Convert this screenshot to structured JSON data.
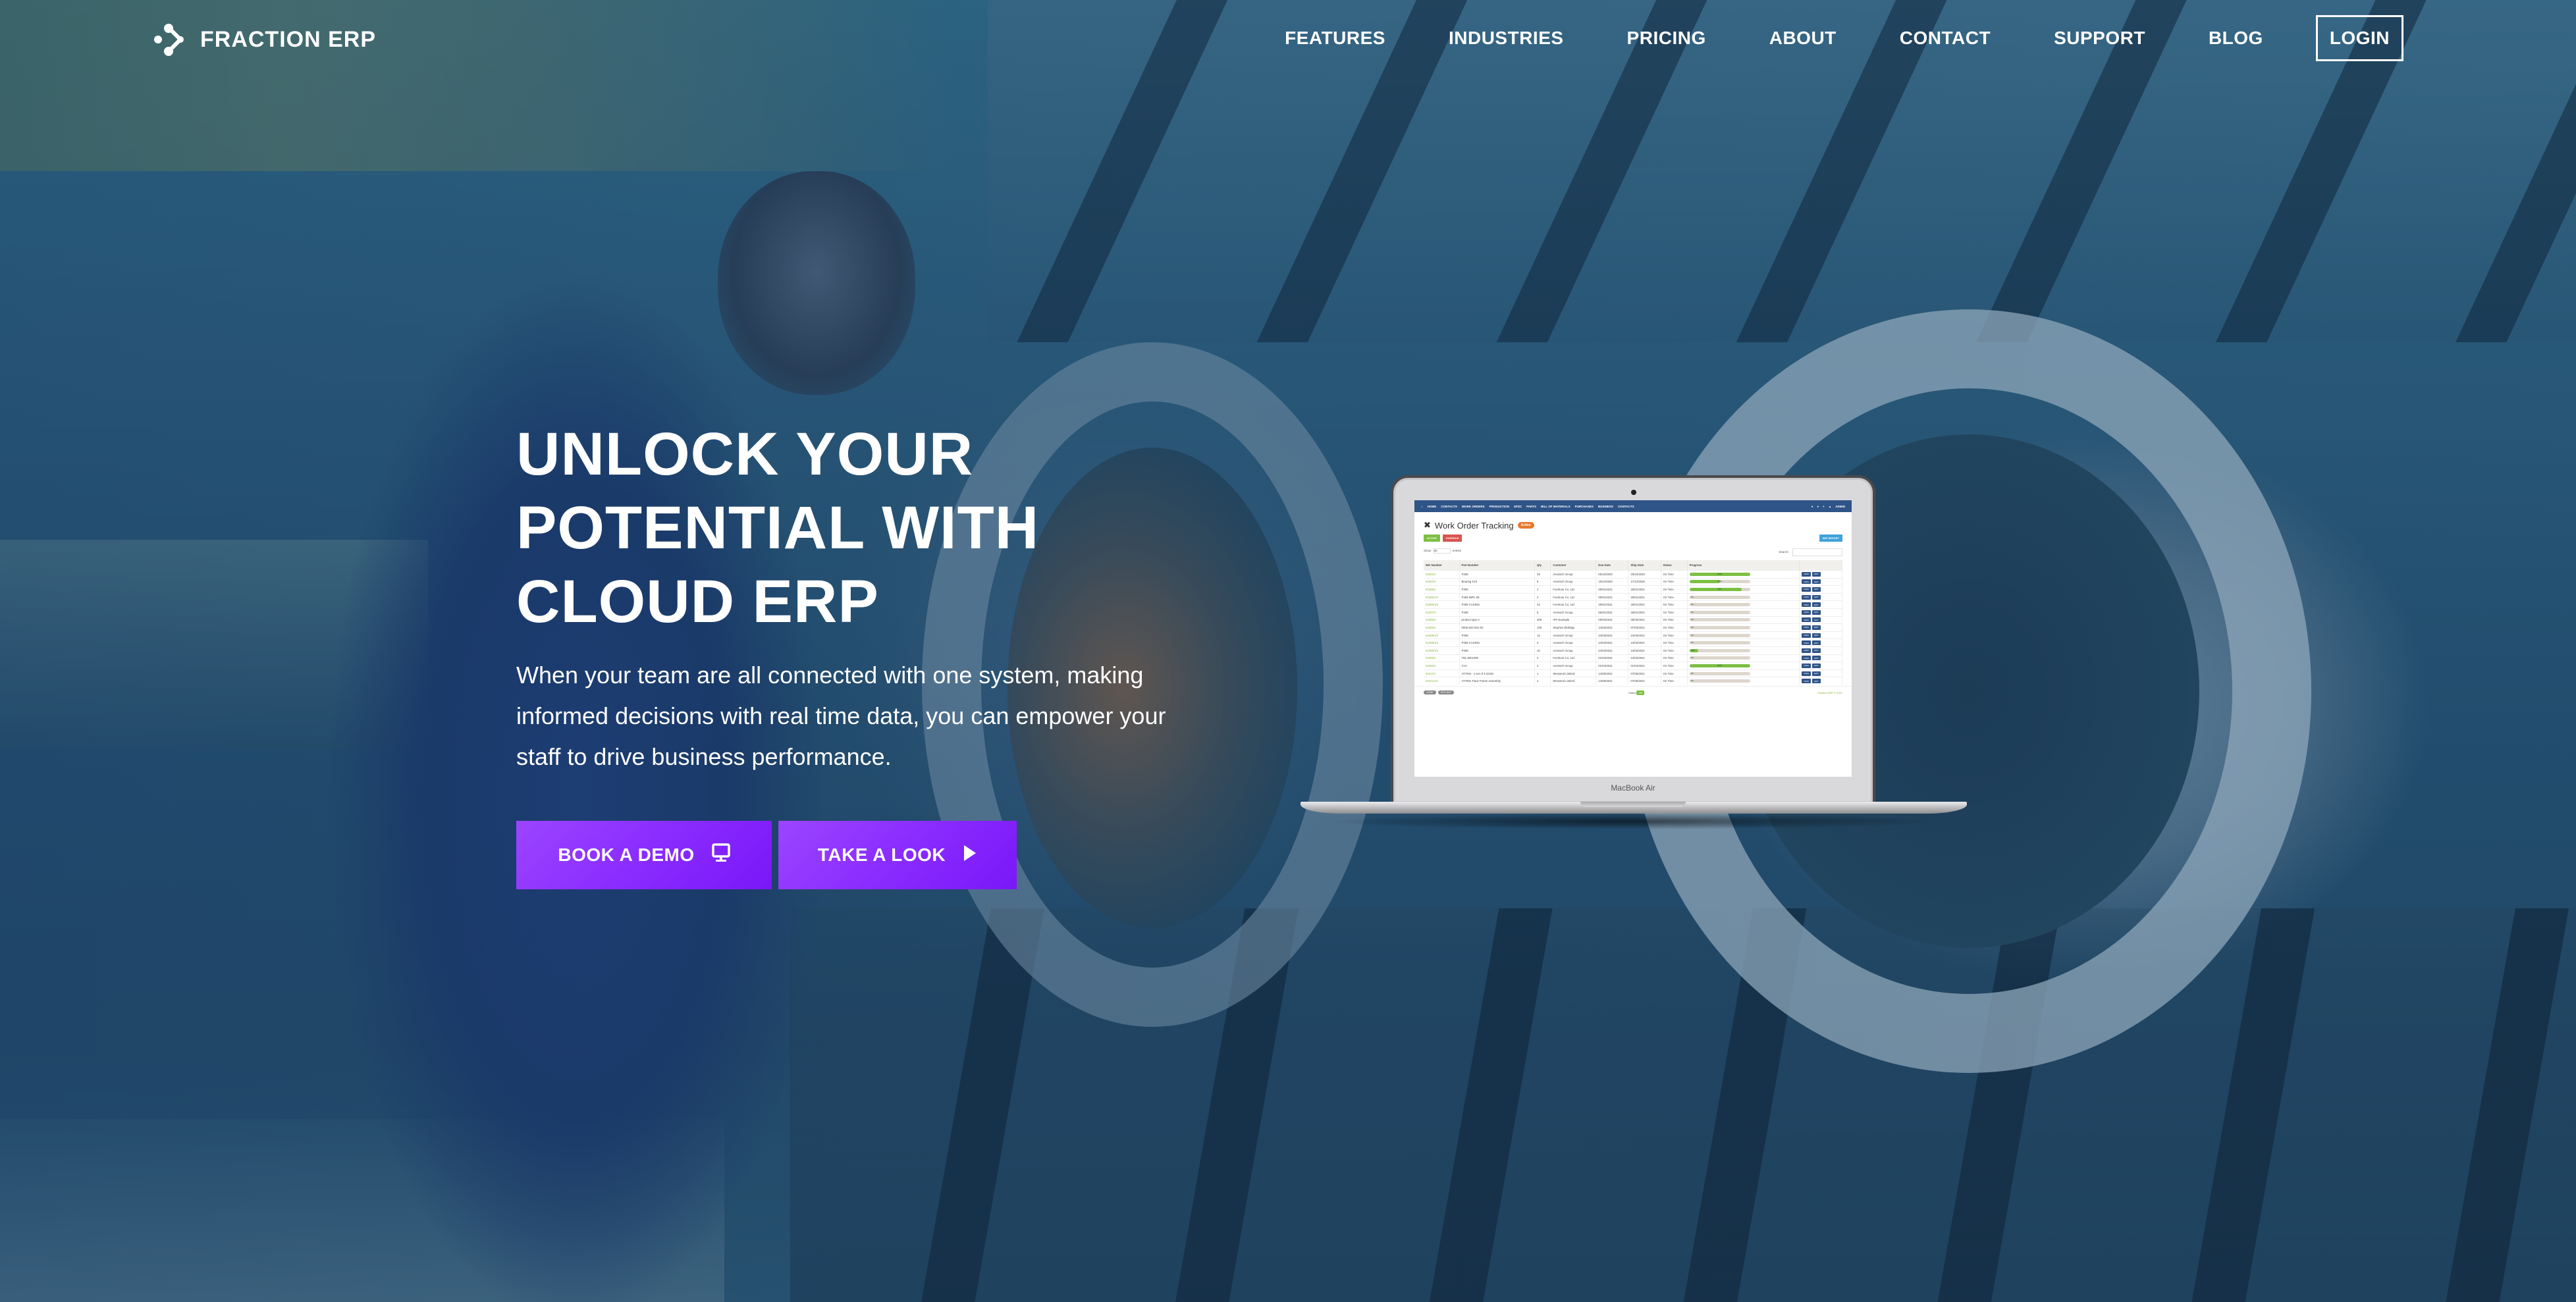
{
  "brand": {
    "name": "FRACTION ERP",
    "logo_icon": "network-nodes-icon"
  },
  "nav": {
    "items": [
      {
        "label": "FEATURES"
      },
      {
        "label": "INDUSTRIES"
      },
      {
        "label": "PRICING"
      },
      {
        "label": "ABOUT"
      },
      {
        "label": "CONTACT"
      },
      {
        "label": "SUPPORT"
      },
      {
        "label": "BLOG"
      }
    ],
    "login_label": "LOGIN"
  },
  "hero": {
    "title_lines": [
      "UNLOCK YOUR",
      "POTENTIAL WITH",
      "CLOUD ERP"
    ],
    "text_lines": [
      "When your team are all connected with one system, making",
      "informed decisions with real time data, you can empower your",
      "staff to drive business performance."
    ],
    "buttons": {
      "demo": {
        "label": "BOOK A DEMO",
        "icon": "monitor-icon"
      },
      "look": {
        "label": "TAKE A LOOK",
        "icon": "play-icon"
      }
    }
  },
  "colors": {
    "button_gradient_start": "#9b45ff",
    "button_gradient_end": "#7a17f7",
    "app_nav": "#2f5487",
    "progress_green": "#7cc043",
    "badge_orange": "#e8792c"
  },
  "mockup": {
    "device_label": "MacBook Air",
    "app": {
      "nav_items": [
        "HOME",
        "CONTACTS",
        "WORK ORDERS",
        "PRODUCTION",
        "SFDC",
        "PARTS",
        "BILL OF MATERIALS",
        "PURCHASES",
        "BUSINESS",
        "CONTACTS"
      ],
      "user_label": "ADMIN",
      "page_title": "Work Order Tracking",
      "title_badge": "Active",
      "filter_buttons": {
        "active": "ACTIVE",
        "overdue": "OVERDUE"
      },
      "report_button": "WIP REPORT",
      "show_label": "Show",
      "show_value": "50",
      "entries_label": "entries",
      "search_label": "Search:",
      "columns": [
        "WO Number",
        "Part Number",
        "Qty",
        "Customer",
        "Due Date",
        "Ship Date",
        "Status",
        "Progress",
        ""
      ],
      "rows": [
        {
          "wo": "01003/1",
          "part": "P308",
          "qty": "33",
          "customer": "Aerotech Group",
          "due": "06/10/2020",
          "ship": "29/10/2020",
          "status": "On Time",
          "progress": 100
        },
        {
          "wo": "01004/1",
          "part": "Bearing K10",
          "qty": "5",
          "customer": "Aerotech Group",
          "due": "18/12/2020",
          "ship": "17/12/2020",
          "status": "On Time",
          "progress": 50
        },
        {
          "wo": "01005/1",
          "part": "P308",
          "qty": "2",
          "customer": "Furniture Co. Ltd",
          "due": "29/01/2021",
          "ship": "26/01/2021",
          "status": "On Time",
          "progress": 86
        },
        {
          "wo": "01005/1/2",
          "part": "P308 IMPL 55",
          "qty": "2",
          "customer": "Furniture Co. Ltd",
          "due": "29/01/2021",
          "ship": "26/01/2021",
          "status": "On Time",
          "progress": 0
        },
        {
          "wo": "01005/1/3",
          "part": "P308 CASING",
          "qty": "44",
          "customer": "Furniture Co. Ltd",
          "due": "29/01/2021",
          "ship": "26/01/2021",
          "status": "On Time",
          "progress": 0
        },
        {
          "wo": "01007/1",
          "part": "P308",
          "qty": "5",
          "customer": "Aerotech Group",
          "due": "06/01/2021",
          "ship": "26/01/2021",
          "status": "On Time",
          "progress": 0
        },
        {
          "wo": "01006/1",
          "part": "product type A",
          "qty": "308",
          "customer": "API Example",
          "due": "09/03/2021",
          "ship": "05/03/2021",
          "status": "On Time",
          "progress": 0
        },
        {
          "wo": "01005/1",
          "part": "0006-520-001-02",
          "qty": "108",
          "customer": "Stephen Eldridge",
          "due": "14/03/2021",
          "ship": "07/03/2021",
          "status": "On Time",
          "progress": 0
        },
        {
          "wo": "01008/1/2",
          "part": "P308",
          "qty": "12",
          "customer": "Aerotech Group",
          "due": "24/03/2021",
          "ship": "24/03/2021",
          "status": "On Time",
          "progress": 0
        },
        {
          "wo": "01008/1/3",
          "part": "P308 CASING",
          "qty": "3",
          "customer": "Aerotech Group",
          "due": "24/03/2021",
          "ship": "24/03/2021",
          "status": "On Time",
          "progress": 0
        },
        {
          "wo": "01008/1/4",
          "part": "P308",
          "qty": "15",
          "customer": "Aerotech Group",
          "due": "24/03/2021",
          "ship": "24/03/2021",
          "status": "On Time",
          "progress": 15
        },
        {
          "wo": "01009/1",
          "part": "TBL 800x400",
          "qty": "2",
          "customer": "Furniture Co. Ltd",
          "due": "01/03/2021",
          "ship": "24/03/2021",
          "status": "On Time",
          "progress": 0
        },
        {
          "wo": "01010/1",
          "part": "CV1",
          "qty": "2",
          "customer": "Aerotech Group",
          "due": "01/04/2021",
          "ship": "01/04/2021",
          "status": "On Time",
          "progress": 100
        },
        {
          "wo": "01011/1",
          "part": "AT700s - 1 set of 4 tracks",
          "qty": "1",
          "customer": "Wessend Limited",
          "due": "14/05/2021",
          "ship": "07/05/2021",
          "status": "On Time",
          "progress": 0
        },
        {
          "wo": "01011/1/2",
          "part": "AT700s Track Frame Assembly",
          "qty": "4",
          "customer": "Wessend Limited",
          "due": "14/05/2021",
          "ship": "07/05/2021",
          "status": "On Time",
          "progress": 0
        }
      ],
      "action_view": "VIEW",
      "action_edit": "EDIT",
      "footer_pills": [
        "HOME",
        "SITE MAP"
      ],
      "footer_status_label": "Status",
      "footer_status_value": "OK",
      "footer_copy": "Fraction ERP © 2021"
    }
  }
}
